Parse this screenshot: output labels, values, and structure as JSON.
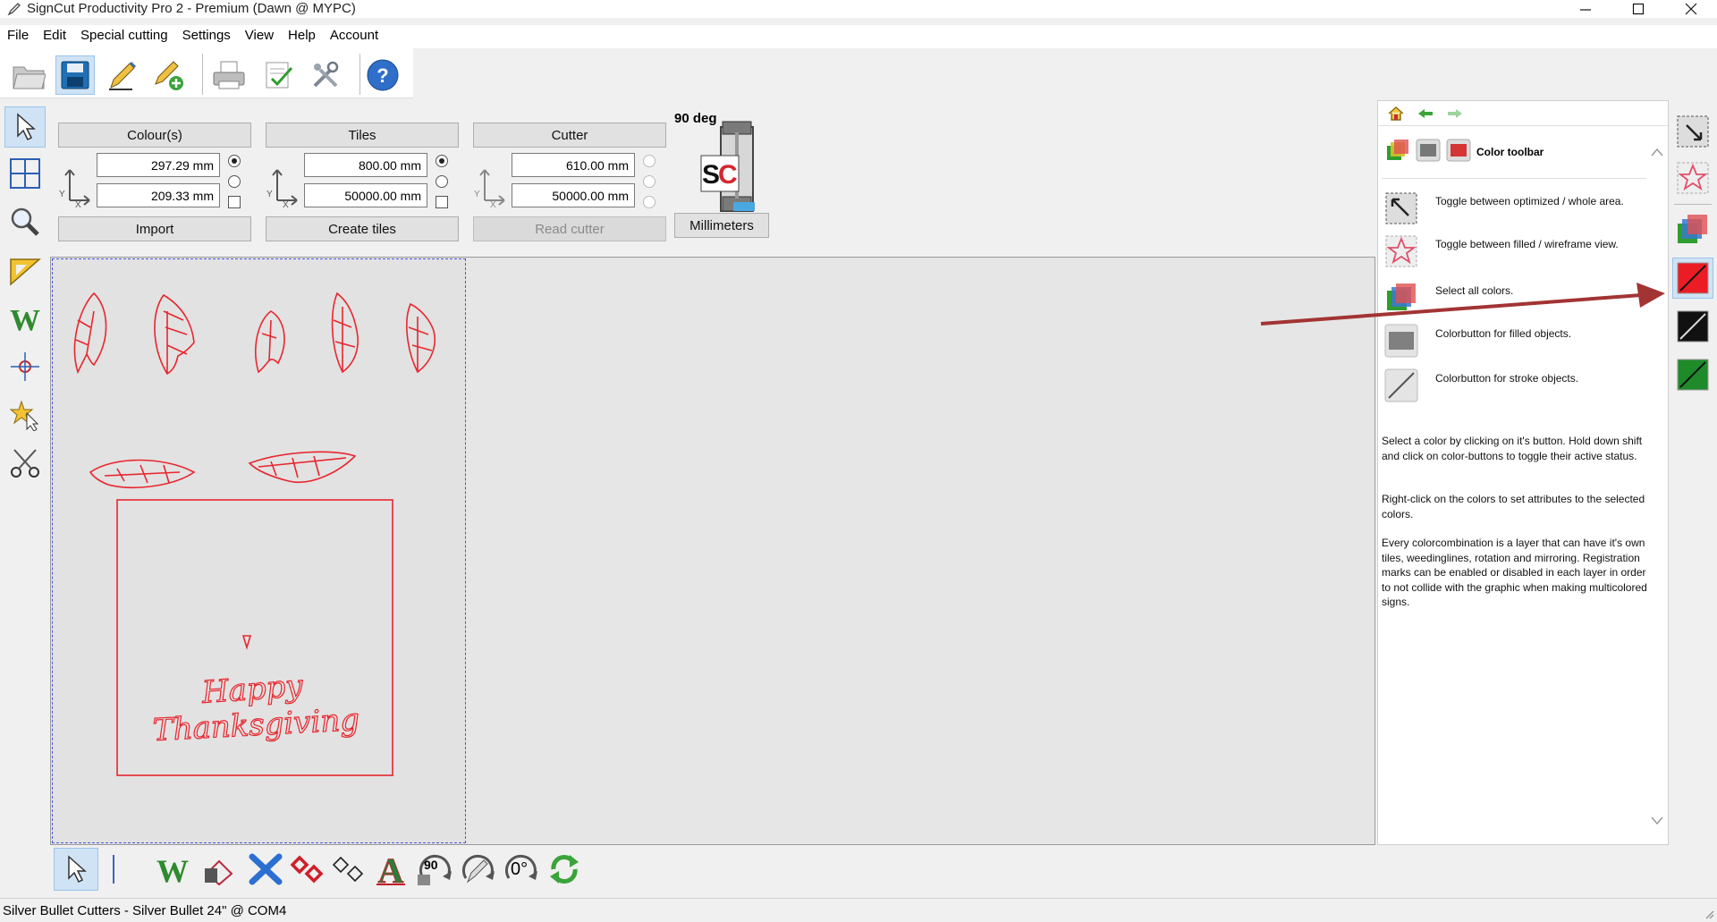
{
  "window": {
    "title": "SignCut Productivity Pro 2 - Premium (Dawn @ MYPC)",
    "minimize": "—",
    "maximize": "☐",
    "close": "✕"
  },
  "menu": [
    "File",
    "Edit",
    "Special cutting",
    "Settings",
    "View",
    "Help",
    "Account"
  ],
  "main_toolbar": {
    "icons": [
      "open-folder-icon",
      "save-icon",
      "edit-pen-icon",
      "add-pen-icon",
      "print-icon",
      "checklist-icon",
      "tools-icon",
      "help-icon"
    ]
  },
  "left_tools": {
    "icons": [
      "select-arrow-icon",
      "grid-tile-icon",
      "magnifier-icon",
      "ruler-triangle-icon",
      "weed-w-icon",
      "crosshair-icon",
      "star-cursor-icon",
      "scissors-icon"
    ]
  },
  "panels": {
    "colours": {
      "header": "Colour(s)",
      "width": "297.29 mm",
      "height": "209.33 mm",
      "action": "Import"
    },
    "tiles": {
      "header": "Tiles",
      "width": "800.00 mm",
      "height": "50000.00 mm",
      "action": "Create tiles"
    },
    "cutter": {
      "header": "Cutter",
      "width": "610.00 mm",
      "height": "50000.00 mm",
      "action": "Read cutter"
    },
    "orientation": {
      "rotation": "90 deg",
      "logo_text": "SC",
      "units": "Millimeters"
    }
  },
  "canvas": {
    "design_text_line1": "Happy",
    "design_text_line2": "Thanksgiving",
    "stroke_color": "#e8262e",
    "page_border_color": "#4b55d6"
  },
  "help_panel": {
    "title": "Color toolbar",
    "items": [
      {
        "icon": "toggle-area-icon",
        "text": "Toggle between optimized / whole area."
      },
      {
        "icon": "star-outline-icon",
        "text": "Toggle between filled / wireframe view."
      },
      {
        "icon": "all-colors-icon",
        "text": "Select all colors."
      },
      {
        "icon": "filled-color-icon",
        "text": "Colorbutton for filled objects."
      },
      {
        "icon": "stroke-color-icon",
        "text": "Colorbutton for stroke objects."
      }
    ],
    "paragraphs": [
      "Select a color by clicking on it's button. Hold down shift and click on color-buttons to toggle their active status.",
      "Right-click on the colors to set attributes to the selected colors.",
      "Every colorcombination is a layer that can have it's own tiles, weedinglines, rotation and mirroring. Registration marks can be enabled or disabled in each layer in order to not collide with the graphic when making multicolored signs."
    ],
    "nav_icons": [
      "home-icon",
      "back-arrow-icon",
      "forward-arrow-icon"
    ]
  },
  "right_tools": {
    "icons": [
      "optimized-area-icon",
      "wireframe-star-icon",
      "select-all-colors-icon",
      "red-color-button-icon",
      "black-color-button-icon",
      "green-color-button-icon"
    ]
  },
  "annotation_arrow_color": "#a33434",
  "bottom_toolbar": {
    "icons": [
      "select-arrow-icon",
      "separator-icon",
      "weed-icon",
      "eraser-fill-icon",
      "mirror-x-icon",
      "diamond-red-icon",
      "diamond-outline-icon",
      "text-a-icon",
      "rotate-90-icon",
      "rotate-pencil-icon",
      "rotate-0-icon",
      "refresh-icon"
    ],
    "rotate90_label": "90",
    "rotate0_label": "0°"
  },
  "status": {
    "text": "Silver Bullet Cutters - Silver Bullet 24\" @ COM4"
  }
}
